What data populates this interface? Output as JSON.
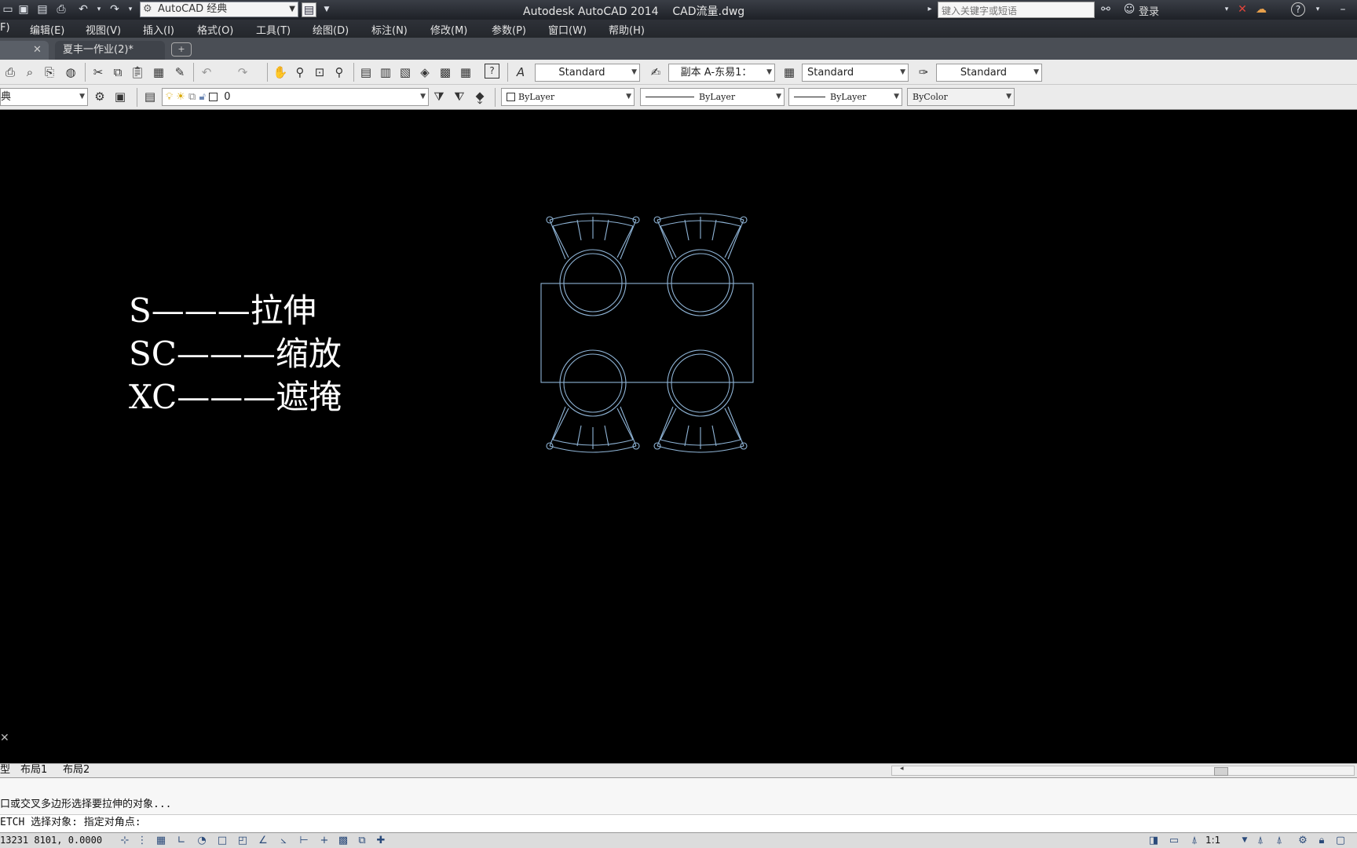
{
  "title_bar": {
    "workspace": "AutoCAD 经典",
    "app_name": "Autodesk AutoCAD 2014",
    "file_name": "CAD流量.dwg",
    "search_placeholder": "键入关键字或短语",
    "login": "登录",
    "help": "?"
  },
  "menu": {
    "items": [
      "F)",
      "编辑(E)",
      "视图(V)",
      "插入(I)",
      "格式(O)",
      "工具(T)",
      "绘图(D)",
      "标注(N)",
      "修改(M)",
      "参数(P)",
      "窗口(W)",
      "帮助(H)"
    ]
  },
  "tabs": {
    "second": "夏丰一作业(2)*"
  },
  "styles": {
    "text_style": "Standard",
    "dim_style": "副本 A-东易1：",
    "table_style": "Standard",
    "mleader_style": "Standard"
  },
  "properties": {
    "workspace_short": "典",
    "layer": "0",
    "color": "ByLayer",
    "linetype": "ByLayer",
    "lineweight": "ByLayer",
    "plot_style": "ByColor"
  },
  "canvas": {
    "notes": [
      "S———拉伸",
      "SC———缩放",
      "XC———遮掩"
    ],
    "background": "#000000",
    "drawing_color": "#8fb4d6"
  },
  "layout_tabs": [
    "型",
    "布局1",
    "布局2"
  ],
  "command": {
    "history": "口或交叉多边形选择要拉伸的对象...",
    "prompt": "ETCH 选择对象: 指定对角点:"
  },
  "status": {
    "coordinates": "13231 8101, 0.0000",
    "annotation_scale": "1:1"
  }
}
